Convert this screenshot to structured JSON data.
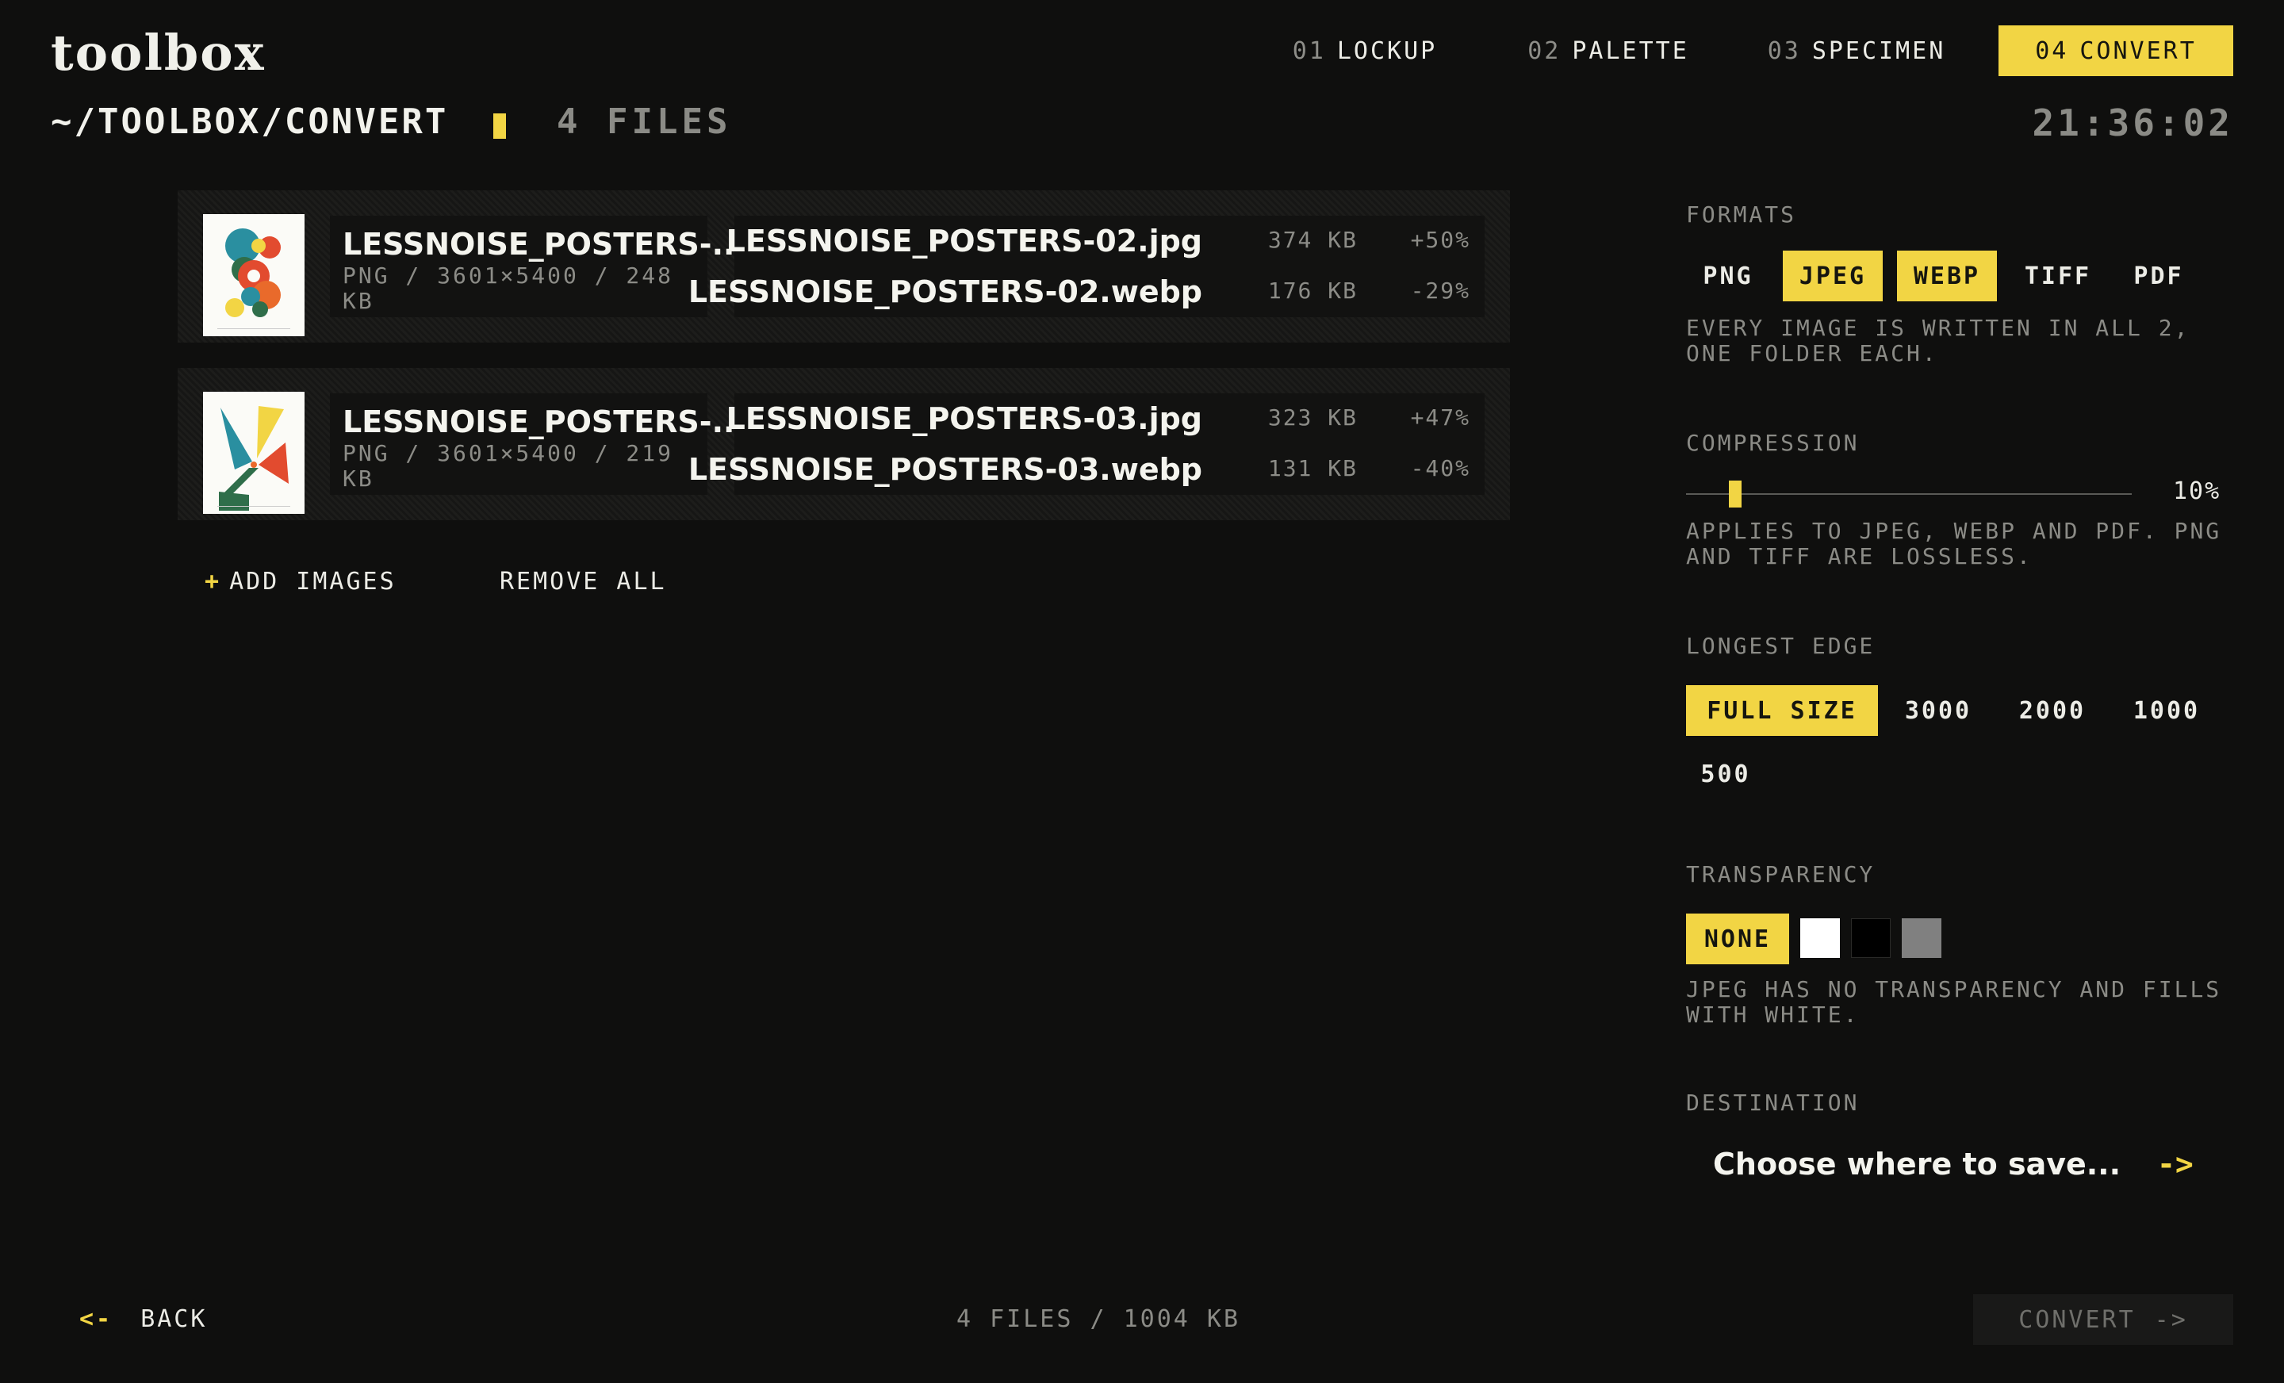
{
  "app": {
    "logo": "toolbox"
  },
  "nav": [
    {
      "num": "01",
      "label": "LOCKUP"
    },
    {
      "num": "02",
      "label": "PALETTE"
    },
    {
      "num": "03",
      "label": "SPECIMEN"
    },
    {
      "num": "04",
      "label": "CONVERT",
      "active": true
    }
  ],
  "header": {
    "path": "~/TOOLBOX/CONVERT",
    "file_count": "4 FILES",
    "clock": "21:36:02"
  },
  "files": [
    {
      "source_name": "LESSNOISE_POSTERS-...",
      "source_meta": "PNG / 3601×5400 / 248 KB",
      "outputs": [
        {
          "name": "LESSNOISE_POSTERS-02.jpg",
          "size": "374 KB",
          "delta": "+50%"
        },
        {
          "name": "LESSNOISE_POSTERS-02.webp",
          "size": "176 KB",
          "delta": "-29%"
        }
      ]
    },
    {
      "source_name": "LESSNOISE_POSTERS-...",
      "source_meta": "PNG / 3601×5400 / 219 KB",
      "outputs": [
        {
          "name": "LESSNOISE_POSTERS-03.jpg",
          "size": "323 KB",
          "delta": "+47%"
        },
        {
          "name": "LESSNOISE_POSTERS-03.webp",
          "size": "131 KB",
          "delta": "-40%"
        }
      ]
    }
  ],
  "actions": {
    "add_plus": "+",
    "add_images": "ADD IMAGES",
    "remove_all": "REMOVE ALL"
  },
  "settings": {
    "formats": {
      "title": "FORMATS",
      "options": [
        "PNG",
        "JPEG",
        "WEBP",
        "TIFF",
        "PDF"
      ],
      "selected": [
        "JPEG",
        "WEBP"
      ],
      "help": "EVERY IMAGE IS WRITTEN IN ALL 2, ONE FOLDER EACH."
    },
    "compression": {
      "title": "COMPRESSION",
      "value": "10%",
      "level": 0.1,
      "help": "APPLIES TO JPEG, WEBP AND PDF. PNG AND TIFF ARE LOSSLESS."
    },
    "longest_edge": {
      "title": "LONGEST EDGE",
      "options": [
        "FULL SIZE",
        "3000",
        "2000",
        "1000",
        "500"
      ],
      "selected": "FULL SIZE"
    },
    "transparency": {
      "title": "TRANSPARENCY",
      "none_label": "NONE",
      "swatches": [
        "#ffffff",
        "#000000",
        "#808080"
      ],
      "help": "JPEG HAS NO TRANSPARENCY AND FILLS WITH WHITE."
    },
    "destination": {
      "title": "DESTINATION",
      "placeholder": "Choose where to save...",
      "arrow": "->"
    }
  },
  "footer": {
    "back_arrow": "<-",
    "back": "BACK",
    "summary": "4 FILES / 1004 KB",
    "convert": "CONVERT",
    "convert_arrow": "->"
  },
  "colors": {
    "accent": "#f2d544",
    "background": "#0f0f0e",
    "muted": "#8b8b86"
  }
}
